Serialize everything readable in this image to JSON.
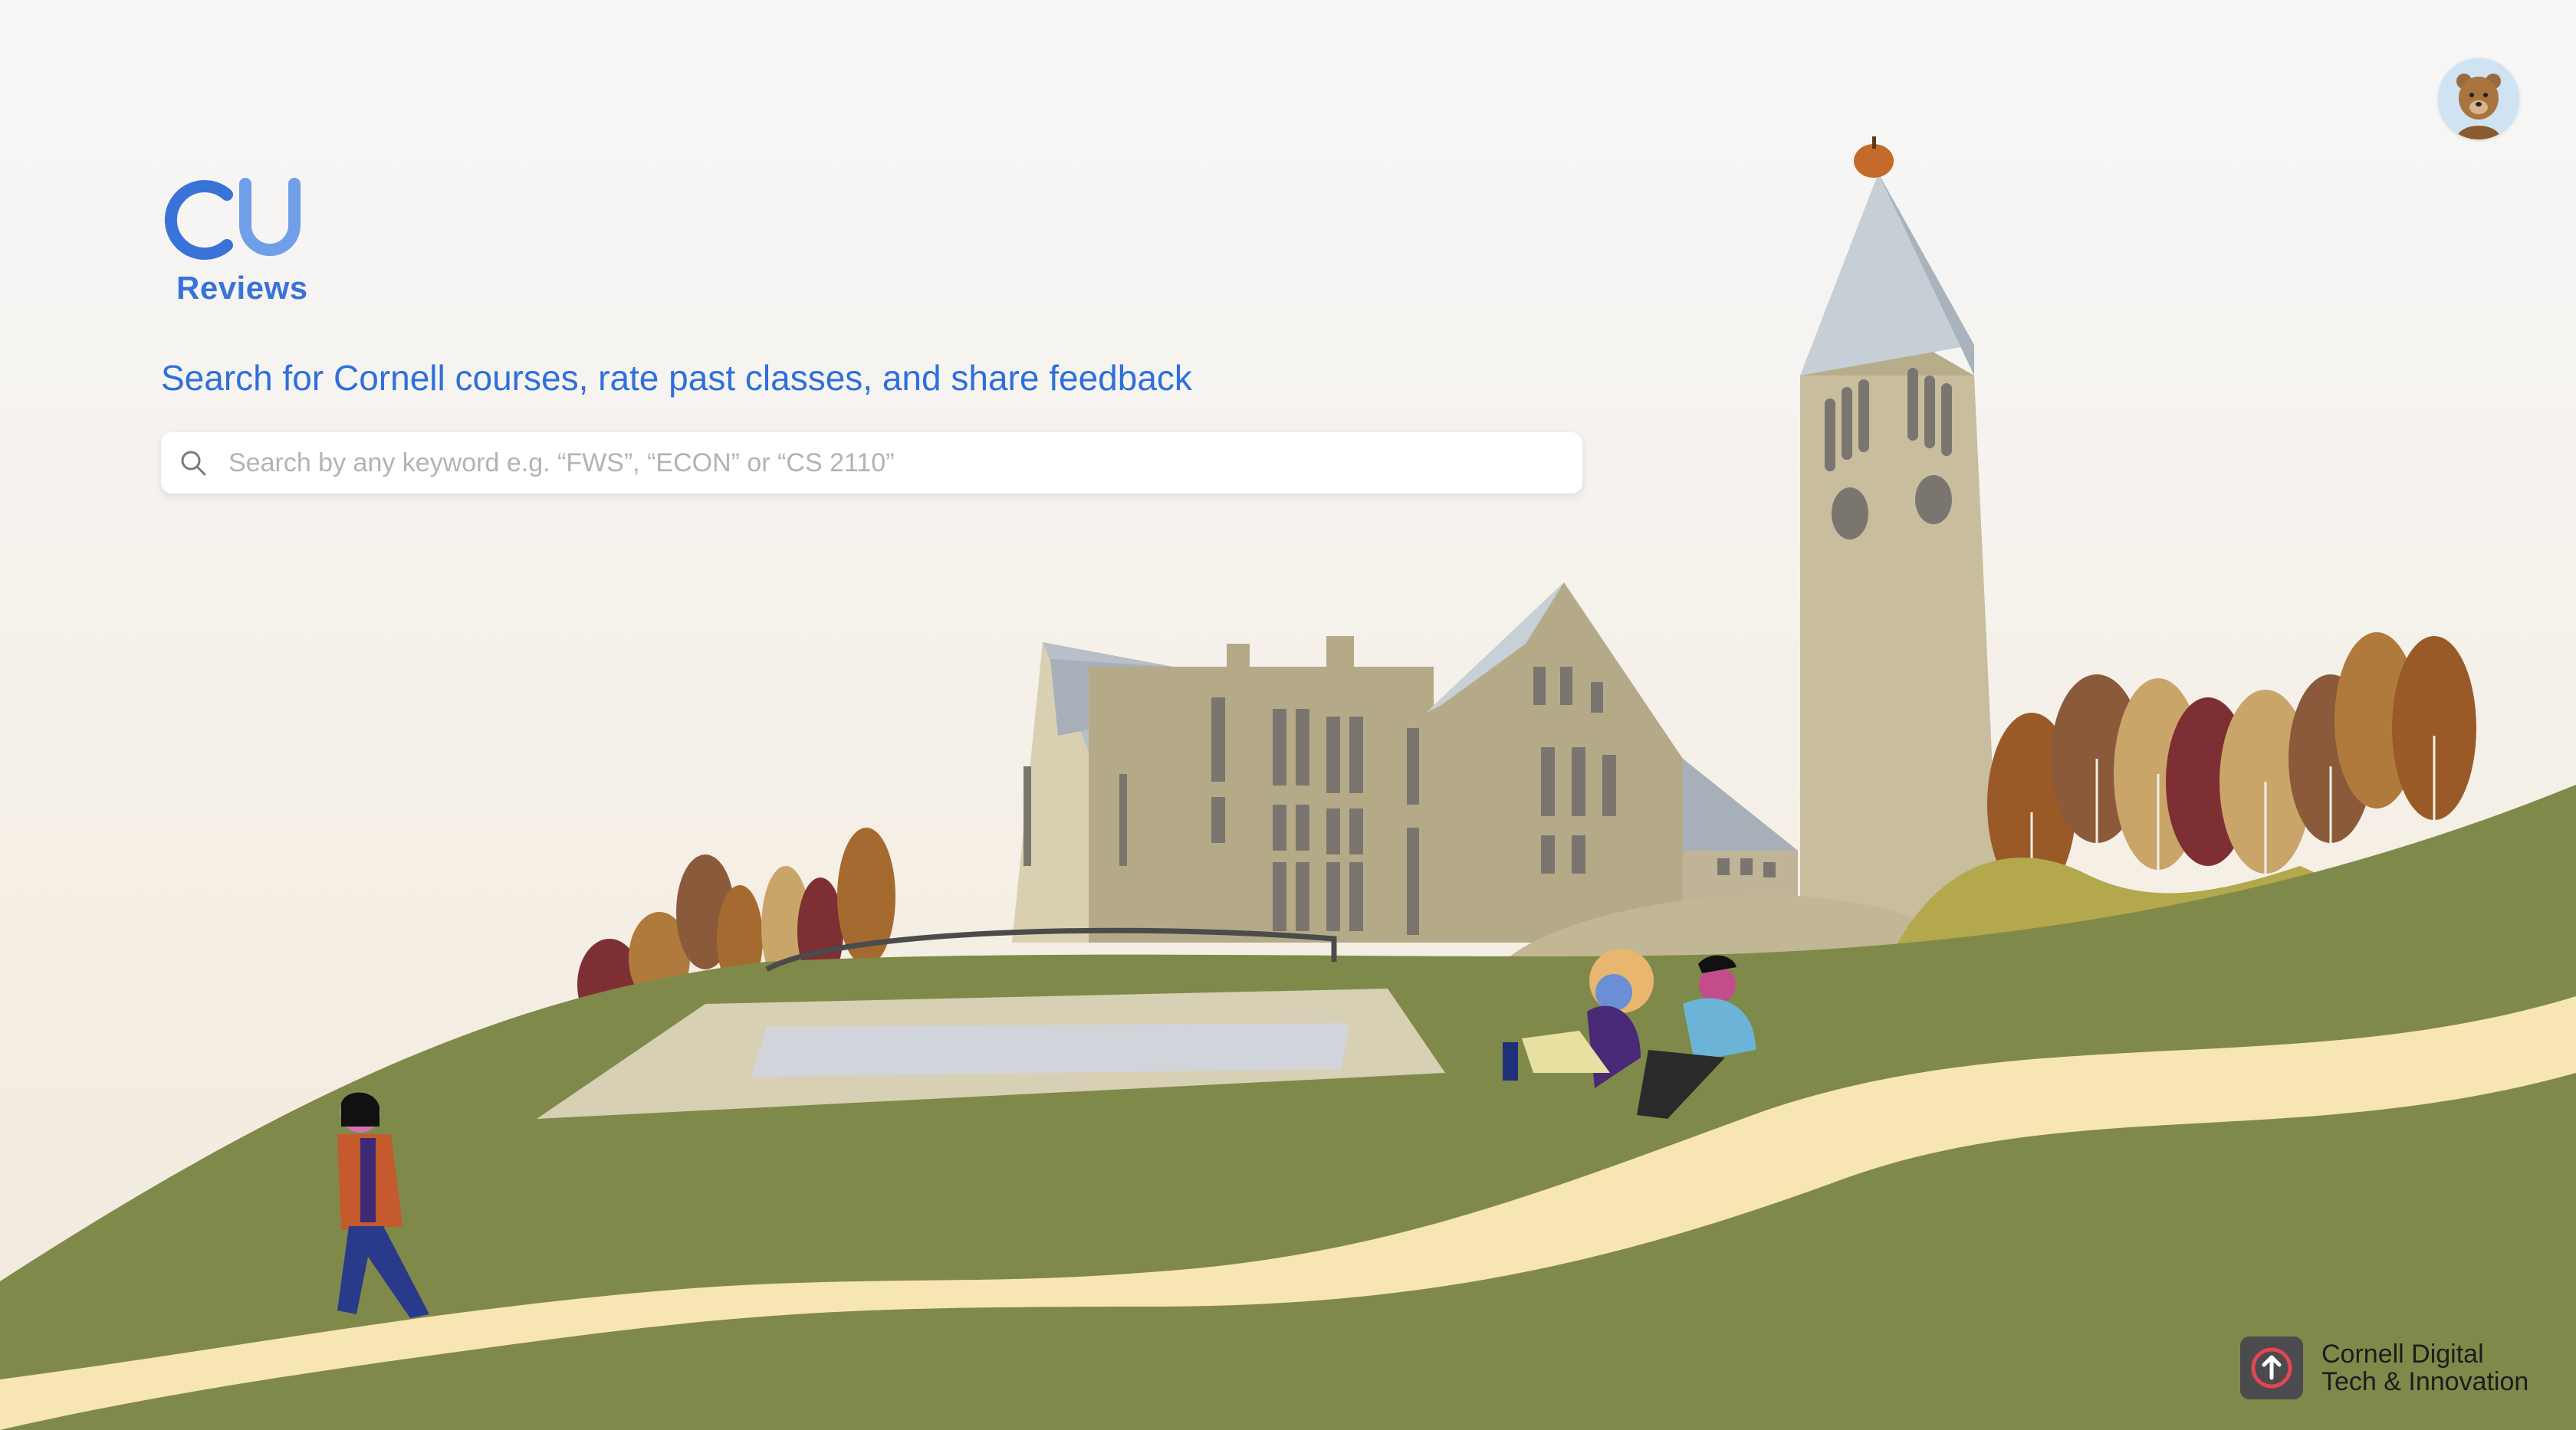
{
  "app": {
    "logo_wordmark": "CU",
    "logo_subtitle": "Reviews",
    "tagline": "Search for Cornell courses, rate past classes, and share feedback"
  },
  "search": {
    "placeholder": "Search by any keyword e.g. “FWS”, “ECON” or “CS 2110”",
    "value": ""
  },
  "account": {
    "avatar_icon": "bear-avatar-icon"
  },
  "footer_brand": {
    "line1": "Cornell Digital",
    "line2": "Tech & Innovation"
  },
  "colors": {
    "accent": "#2e6fdb",
    "grass": "#7f8a4a",
    "path": "#f7e5b3",
    "building": "#b5aa88"
  }
}
